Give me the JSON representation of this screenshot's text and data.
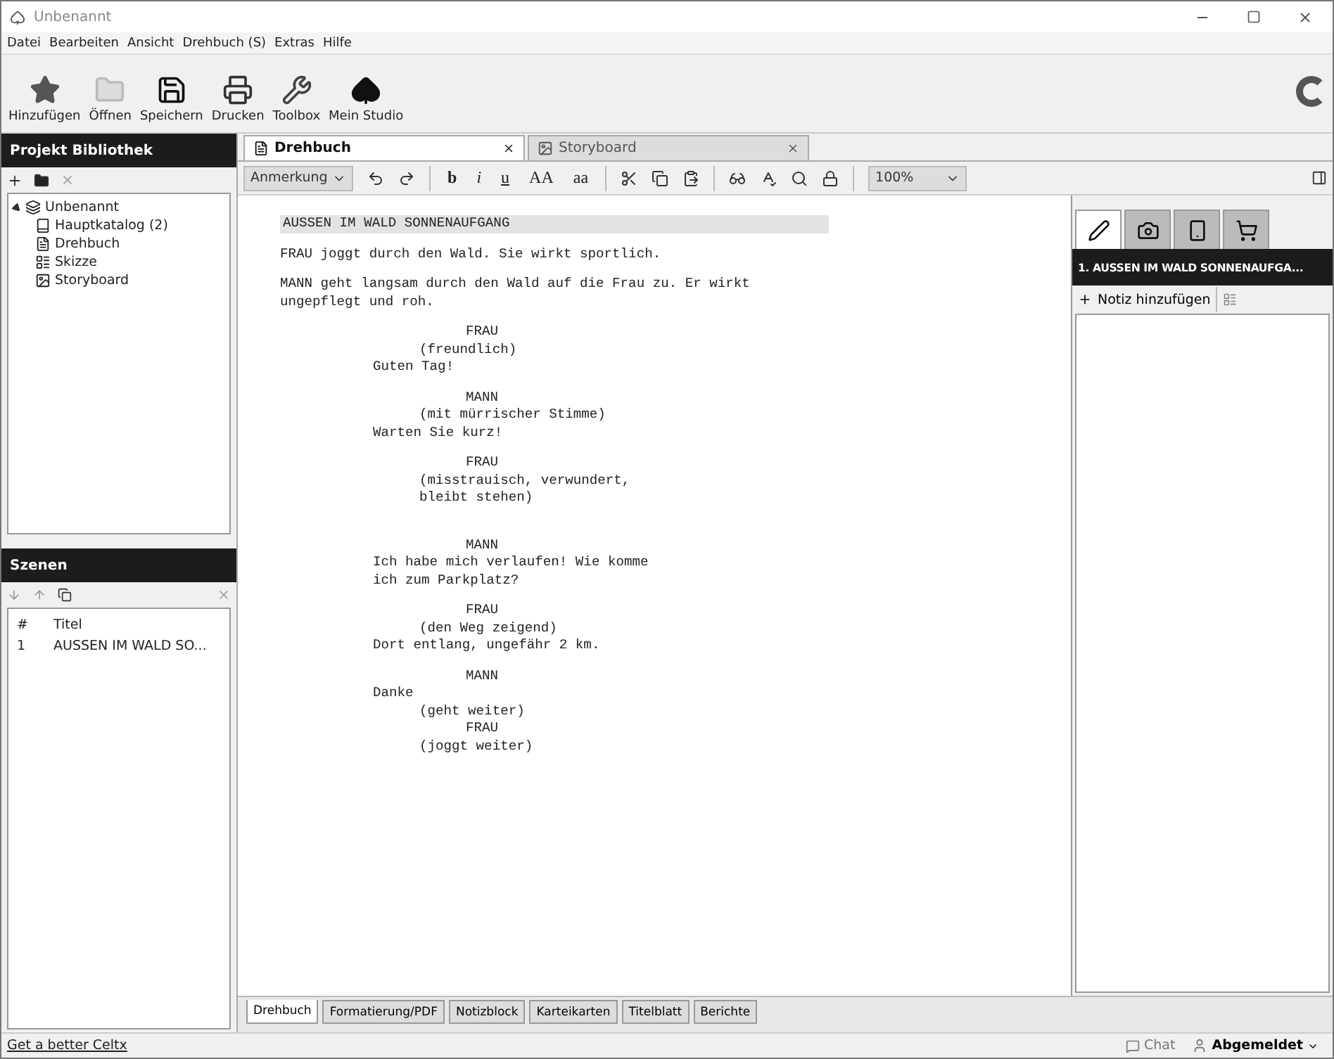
{
  "window": {
    "title": "Unbenannt"
  },
  "menu": [
    "Datei",
    "Bearbeiten",
    "Ansicht",
    "Drehbuch (S)",
    "Extras",
    "Hilfe"
  ],
  "toolbar": [
    {
      "label": "Hinzufügen",
      "kind": "add"
    },
    {
      "label": "Öffnen",
      "kind": "open"
    },
    {
      "label": "Speichern",
      "kind": "save"
    },
    {
      "label": "Drucken",
      "kind": "print"
    },
    {
      "label": "Toolbox",
      "kind": "tool"
    },
    {
      "label": "Mein Studio",
      "kind": "studio"
    }
  ],
  "library": {
    "title": "Projekt Bibliothek",
    "tree": [
      {
        "label": "Unbenannt",
        "expanded": true,
        "children": [
          {
            "label": "Hauptkatalog (2)"
          },
          {
            "label": "Drehbuch"
          },
          {
            "label": "Skizze"
          },
          {
            "label": "Storyboard"
          }
        ]
      }
    ]
  },
  "scenes": {
    "title": "Szenen",
    "columns": [
      "#",
      "Titel"
    ],
    "rows": [
      [
        "1",
        "AUSSEN IM WALD SO..."
      ]
    ]
  },
  "doc_tabs": [
    {
      "label": "Drehbuch",
      "selected": true
    },
    {
      "label": "Storyboard",
      "selected": false
    }
  ],
  "format": {
    "element": "Anmerkung",
    "buttons": [
      "b",
      "i",
      "u",
      "AA",
      "aa"
    ],
    "zoom": "100%"
  },
  "script": [
    {
      "kind": "scene",
      "text": "AUSSEN IM WALD SONNENAUFGANG"
    },
    {
      "kind": "action",
      "text": "FRAU joggt durch den Wald. Sie wirkt sportlich."
    },
    {
      "kind": "action",
      "text": "MANN geht langsam durch den Wald auf die Frau zu. Er wirkt\nungepflegt und roh."
    },
    {
      "kind": "character",
      "text": "FRAU"
    },
    {
      "kind": "parenthetical",
      "text": "(freundlich)"
    },
    {
      "kind": "dialogue",
      "text": "Guten Tag!"
    },
    {
      "kind": "character",
      "text": "MANN"
    },
    {
      "kind": "parenthetical",
      "text": "(mit mürrischer Stimme)"
    },
    {
      "kind": "dialogue",
      "text": "Warten Sie kurz!"
    },
    {
      "kind": "character",
      "text": "FRAU"
    },
    {
      "kind": "parenthetical",
      "text": "(misstrauisch, verwundert,\nbleibt stehen)"
    },
    {
      "kind": "blank"
    },
    {
      "kind": "character",
      "text": "MANN"
    },
    {
      "kind": "dialogue",
      "text": "Ich habe mich verlaufen! Wie komme\nich zum Parkplatz?"
    },
    {
      "kind": "character",
      "text": "FRAU"
    },
    {
      "kind": "parenthetical",
      "text": "(den Weg zeigend)"
    },
    {
      "kind": "dialogue",
      "text": "Dort entlang, ungefähr 2 km."
    },
    {
      "kind": "character",
      "text": "MANN"
    },
    {
      "kind": "dialogue",
      "text": "Danke"
    },
    {
      "kind": "parenthetical",
      "text": "(geht weiter)"
    },
    {
      "kind": "character",
      "text": "FRAU"
    },
    {
      "kind": "parenthetical",
      "text": "(joggt weiter)"
    }
  ],
  "notes": {
    "tabs": [
      {
        "kind": "pen",
        "selected": true
      },
      {
        "kind": "camera",
        "selected": false
      },
      {
        "kind": "phone",
        "selected": false
      },
      {
        "kind": "cart",
        "selected": false
      }
    ],
    "scene": "1. AUSSEN IM WALD SONNENAUFGA...",
    "add": "Notiz hinzufügen"
  },
  "bottom_tabs": [
    {
      "label": "Drehbuch",
      "selected": true
    },
    {
      "label": "Formatierung/PDF",
      "selected": false
    },
    {
      "label": "Notizblock",
      "selected": false
    },
    {
      "label": "Karteikarten",
      "selected": false
    },
    {
      "label": "Titelblatt",
      "selected": false
    },
    {
      "label": "Berichte",
      "selected": false
    }
  ],
  "status_bar": {
    "link": "Get a better Celtx",
    "chat": "Chat",
    "user": "Abgemeldet"
  }
}
